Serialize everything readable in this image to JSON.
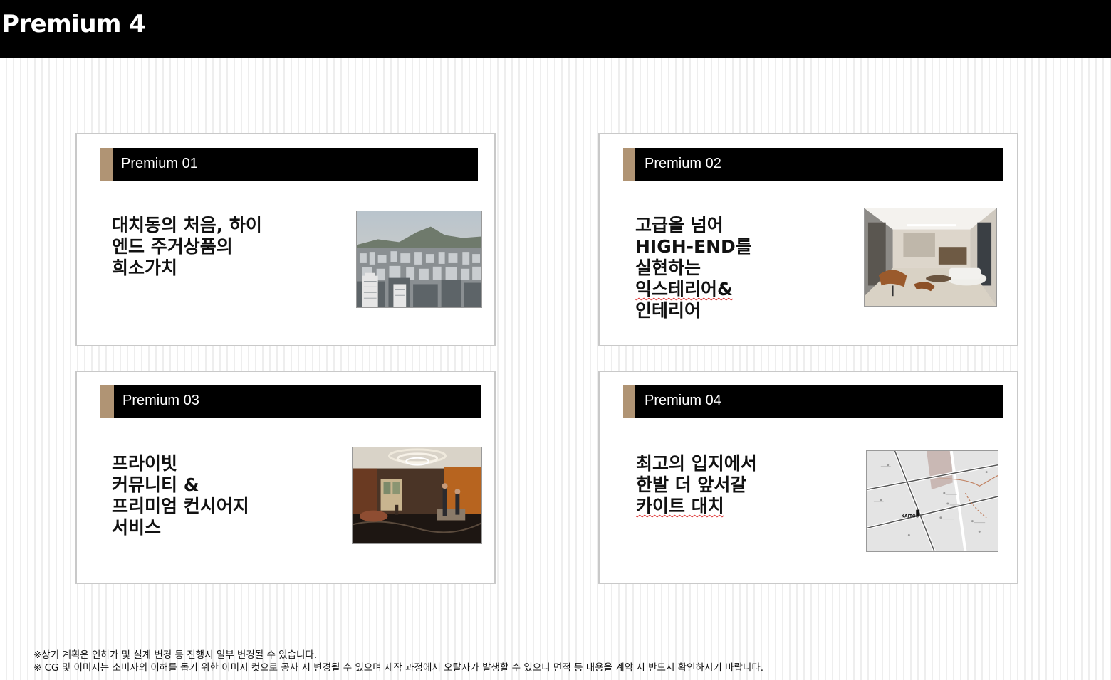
{
  "page": {
    "title": "Premium 4"
  },
  "cards": [
    {
      "label": "Premium 01",
      "headline": "대치동의 처음, 하이\n엔드 주거상품의\n희소가치",
      "image": "city-skyline-photo"
    },
    {
      "label": "Premium 02",
      "headline_lines": [
        "고급을 넘어",
        "HIGH-END를",
        "실현하는",
        "익스테리어&",
        "인테리어"
      ],
      "image": "interior-living-room-photo"
    },
    {
      "label": "Premium 03",
      "headline": "프라이빗\n커뮤니티 &\n프리미엄 컨시어지\n서비스",
      "image": "lobby-chandelier-photo"
    },
    {
      "label": "Premium 04",
      "headline_lines": [
        "최고의 입지에서",
        "한발 더 앞서갈",
        "카이트 대치"
      ],
      "image": "location-map-image",
      "map_marker": "KAITOS"
    }
  ],
  "colors": {
    "accent": "#b09474",
    "header": "#000000"
  },
  "notes": [
    "※상기 계획은 인허가 및 설계 변경 등 진행시 일부 변경될 수 있습니다.",
    "※ CG 및 이미지는 소비자의 이해를 돕기 위한 이미지 컷으로 공사 시 변경될 수 있으며 제작 과정에서 오탈자가 발생할 수 있으니 면적 등 내용을 계약 시 반드시 확인하시기 바랍니다."
  ]
}
